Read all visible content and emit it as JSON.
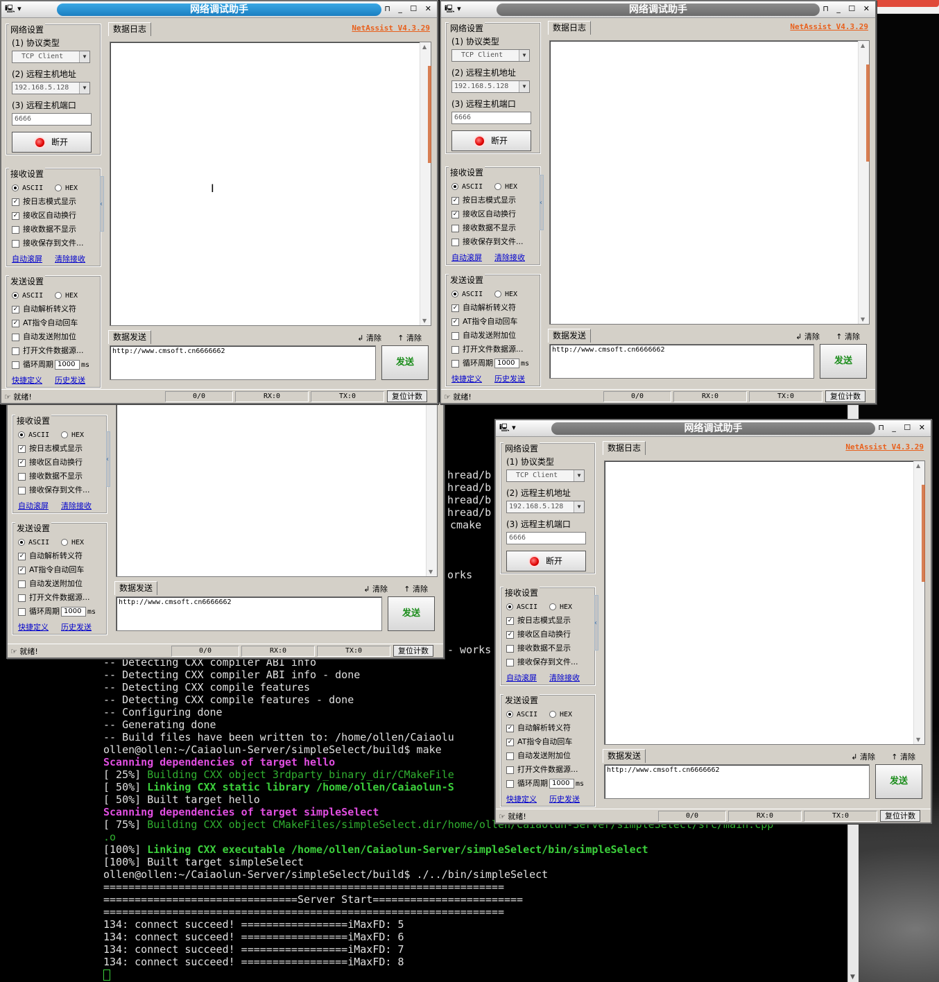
{
  "app": {
    "title": "网络调试助手",
    "brand": "NetAssist V4.3.29",
    "sysmenu": "🖳 ▾",
    "title_buttons": "⊓ _ ☐ ✕"
  },
  "net": {
    "group": "网络设置",
    "protocol_label": "(1) 协议类型",
    "protocol_value": "TCP Client",
    "host_label": "(2) 远程主机地址",
    "host_value": "192.168.5.128",
    "port_label": "(3) 远程主机端口",
    "port_value": "6666",
    "disconnect_label": "断开"
  },
  "recv": {
    "group": "接收设置",
    "ascii": "ASCII",
    "hex": "HEX",
    "log_mode": "按日志模式显示",
    "auto_wrap": "接收区自动换行",
    "hide_data": "接收数据不显示",
    "save_file": "接收保存到文件...",
    "auto_scroll": "自动滚屏",
    "clear_recv": "清除接收"
  },
  "send": {
    "group": "发送设置",
    "ascii": "ASCII",
    "hex": "HEX",
    "parse_escape": "自动解析转义符",
    "at_cr": "AT指令自动回车",
    "append_bit": "自动发送附加位",
    "open_file": "打开文件数据源...",
    "cycle_label": "循环周期",
    "cycle_value": "1000",
    "cycle_unit": "ms",
    "shortcut": "快捷定义",
    "history": "历史发送"
  },
  "main": {
    "log_tab": "数据日志",
    "send_tab": "数据发送",
    "clear1": "清除",
    "clear2": "清除",
    "send_text": "http://www.cmsoft.cn6666662",
    "send_button": "发送"
  },
  "status": {
    "ready": "就绪!",
    "count": "0/0",
    "rx": "RX:0",
    "tx": "TX:0",
    "reset": "复位计数"
  },
  "terminal": {
    "lines": [
      {
        "cls": "t-w",
        "text": "-- Detecting CXX compiler ABI info"
      },
      {
        "cls": "t-w",
        "text": "-- Detecting CXX compiler ABI info - done"
      },
      {
        "cls": "t-w",
        "text": "-- Detecting CXX compile features"
      },
      {
        "cls": "t-w",
        "text": "-- Detecting CXX compile features - done"
      },
      {
        "cls": "t-w",
        "text": "-- Configuring done"
      },
      {
        "cls": "t-w",
        "text": "-- Generating done"
      },
      {
        "cls": "t-w",
        "text": "-- Build files have been written to: /home/ollen/Caiaolu"
      },
      {
        "cls": "t-w",
        "text": "ollen@ollen:~/Caiaolun-Server/simpleSelect/build$ make"
      },
      {
        "cls": "t-m",
        "text": "Scanning dependencies of target hello"
      },
      {
        "cls": "t-w",
        "text": "[ 25%] ",
        "rest": "Building CXX object 3rdparty_binary_dir/CMakeFile",
        "restcls": "t-g"
      },
      {
        "cls": "t-w",
        "text": "[ 50%] ",
        "rest": "Linking CXX static library /home/ollen/Caiaolun-S",
        "restcls": "t-gb"
      },
      {
        "cls": "t-w",
        "text": "[ 50%] Built target hello"
      },
      {
        "cls": "t-m",
        "text": "Scanning dependencies of target simpleSelect"
      },
      {
        "cls": "t-w",
        "text": "[ 75%] ",
        "rest": "Building CXX object CMakeFiles/simpleSelect.dir/home/ollen/Caiaolun-Server/simpleSelect/src/main.cpp",
        "restcls": "t-g"
      },
      {
        "cls": "t-g",
        "text": ".o"
      },
      {
        "cls": "t-w",
        "text": "[100%] ",
        "rest": "Linking CXX executable /home/ollen/Caiaolun-Server/simpleSelect/bin/simpleSelect",
        "restcls": "t-gb"
      },
      {
        "cls": "t-w",
        "text": "[100%] Built target simpleSelect"
      },
      {
        "cls": "t-w",
        "text": "ollen@ollen:~/Caiaolun-Server/simpleSelect/build$ ./../bin/simpleSelect"
      },
      {
        "cls": "t-w",
        "text": "================================================================"
      },
      {
        "cls": "t-w",
        "text": "===============================Server Start========================"
      },
      {
        "cls": "t-w",
        "text": "================================================================"
      },
      {
        "cls": "t-w",
        "text": "134: connect succeed! =================iMaxFD: 5"
      },
      {
        "cls": "t-w",
        "text": "134: connect succeed! =================iMaxFD: 6"
      },
      {
        "cls": "t-w",
        "text": "134: connect succeed! =================iMaxFD: 7"
      },
      {
        "cls": "t-w",
        "text": "134: connect succeed! =================iMaxFD: 8"
      }
    ],
    "fragments": [
      "hread/b",
      "hread/b",
      "hread/b",
      "hread/b",
      "cmake",
      "orks",
      "- works"
    ]
  }
}
